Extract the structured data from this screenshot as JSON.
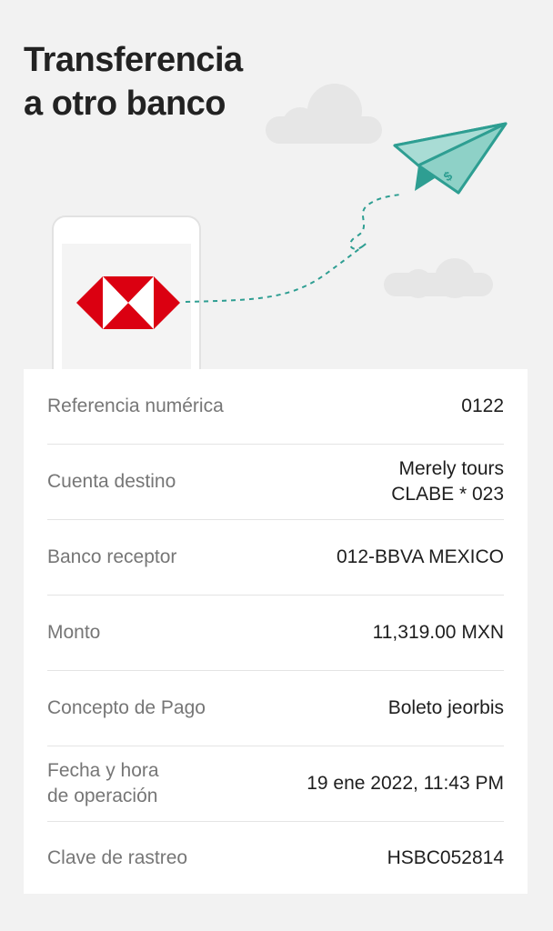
{
  "header": {
    "title_line1": "Transferencia",
    "title_line2": "a otro banco"
  },
  "illustration": {
    "logo": "hsbc-hexagon-logo",
    "logo_color": "#db0011",
    "plane_color": "#2e9e92",
    "plane_icon": "paper-plane-dollar-icon"
  },
  "details": {
    "rows": [
      {
        "label": "Referencia numérica",
        "value": "0122"
      },
      {
        "label": "Cuenta destino",
        "value_line1": "Merely tours",
        "value_line2": "CLABE * 023"
      },
      {
        "label": "Banco receptor",
        "value": "012-BBVA MEXICO"
      },
      {
        "label": "Monto",
        "value": "11,319.00 MXN"
      },
      {
        "label": "Concepto de Pago",
        "value": "Boleto jeorbis"
      },
      {
        "label_line1": "Fecha y hora",
        "label_line2": "de operación",
        "value": "19 ene 2022, 11:43 PM"
      },
      {
        "label": "Clave de rastreo",
        "value": "HSBC052814"
      }
    ]
  }
}
